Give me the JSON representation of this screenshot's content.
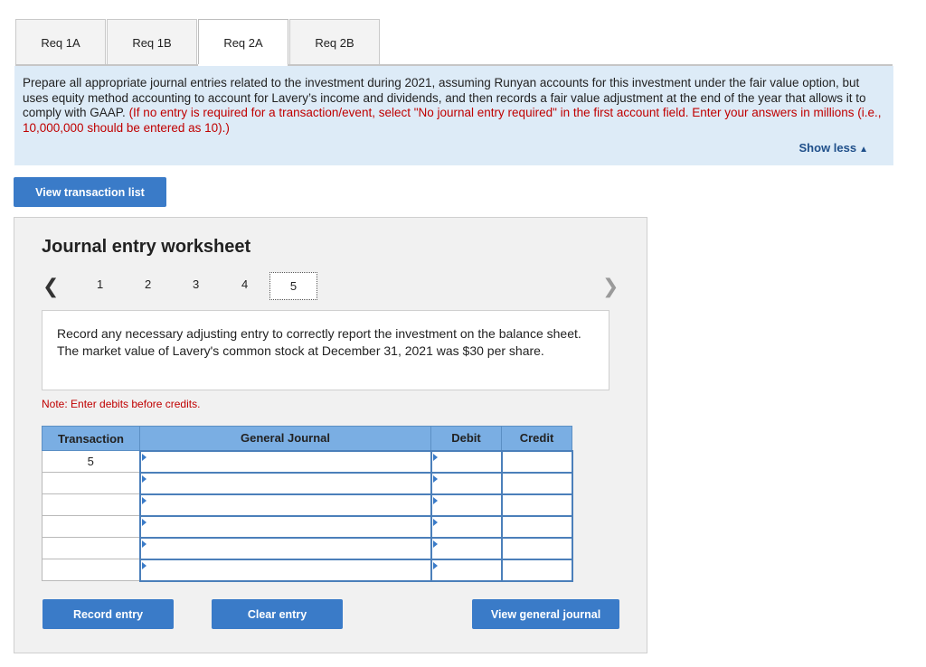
{
  "tabs": [
    {
      "label": "Req 1A",
      "active": false
    },
    {
      "label": "Req 1B",
      "active": false
    },
    {
      "label": "Req 2A",
      "active": true
    },
    {
      "label": "Req 2B",
      "active": false
    }
  ],
  "instructions": {
    "text": "Prepare all appropriate journal entries related to the investment during 2021, assuming Runyan accounts for this investment under the fair value option, but uses equity method accounting to account for Lavery’s income and dividends, and then records a fair value adjustment at the end of the year that allows it to comply with GAAP.",
    "note_red": "(If no entry is required for a transaction/event, select \"No journal entry required\" in the first account field. Enter your answers in millions (i.e., 10,000,000 should be entered as 10).)",
    "show_less": "Show less"
  },
  "view_transaction_list": "View transaction list",
  "worksheet": {
    "title": "Journal entry worksheet",
    "pages": [
      "1",
      "2",
      "3",
      "4",
      "5"
    ],
    "current_page": "5",
    "prompt": "Record any necessary adjusting entry to correctly report the investment on the balance sheet. The market value of Lavery's common stock at December 31, 2021 was $30 per share.",
    "note": "Note: Enter debits before credits.",
    "table": {
      "headers": {
        "transaction": "Transaction",
        "general_journal": "General Journal",
        "debit": "Debit",
        "credit": "Credit"
      },
      "rows": [
        {
          "transaction": "5",
          "account": "",
          "debit": "",
          "credit": ""
        },
        {
          "transaction": "",
          "account": "",
          "debit": "",
          "credit": ""
        },
        {
          "transaction": "",
          "account": "",
          "debit": "",
          "credit": ""
        },
        {
          "transaction": "",
          "account": "",
          "debit": "",
          "credit": ""
        },
        {
          "transaction": "",
          "account": "",
          "debit": "",
          "credit": ""
        },
        {
          "transaction": "",
          "account": "",
          "debit": "",
          "credit": ""
        }
      ]
    },
    "buttons": {
      "record": "Record entry",
      "clear": "Clear entry",
      "view_general": "View general journal"
    }
  },
  "icons": {
    "prev": "chevron-left-icon",
    "next": "chevron-right-icon",
    "show_less": "triangle-up-icon"
  },
  "colors": {
    "accent": "#3a7bc8",
    "instruction_bg": "#ddebf7",
    "table_header": "#7aaee3",
    "red_text": "#c00000"
  }
}
